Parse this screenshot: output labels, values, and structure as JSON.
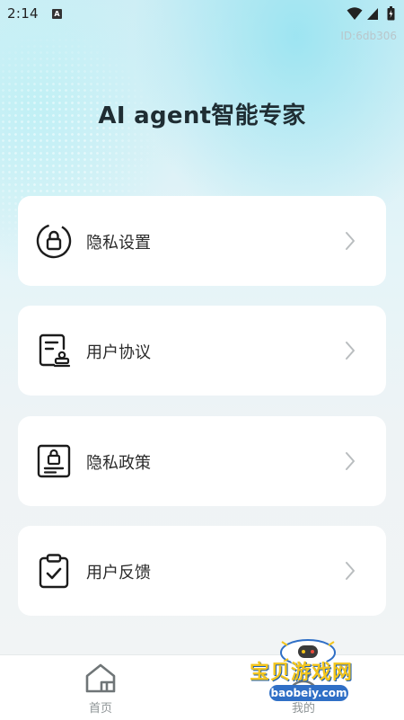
{
  "status_bar": {
    "time": "2:14",
    "notification_badge": "A",
    "icons": [
      "wifi-icon",
      "signal-icon",
      "battery-icon"
    ]
  },
  "header": {
    "id_label": "ID:6db306",
    "title": "AI agent智能专家"
  },
  "menu": [
    {
      "label": "隐私设置",
      "icon": "lock-circle-icon"
    },
    {
      "label": "用户协议",
      "icon": "document-stamp-icon"
    },
    {
      "label": "隐私政策",
      "icon": "lock-document-icon"
    },
    {
      "label": "用户反馈",
      "icon": "clipboard-check-icon"
    }
  ],
  "tab_bar": {
    "tabs": [
      {
        "label": "首页",
        "icon": "home-icon"
      },
      {
        "label": "我的",
        "icon": "profile-icon"
      }
    ]
  },
  "watermark": {
    "text": "宝贝游戏网",
    "url": "baobeiy.com"
  },
  "colors": {
    "accent_green": "#30d3a5",
    "text_dark": "#1f2d33",
    "card_bg": "#ffffff",
    "tab_inactive": "#8e9496"
  }
}
